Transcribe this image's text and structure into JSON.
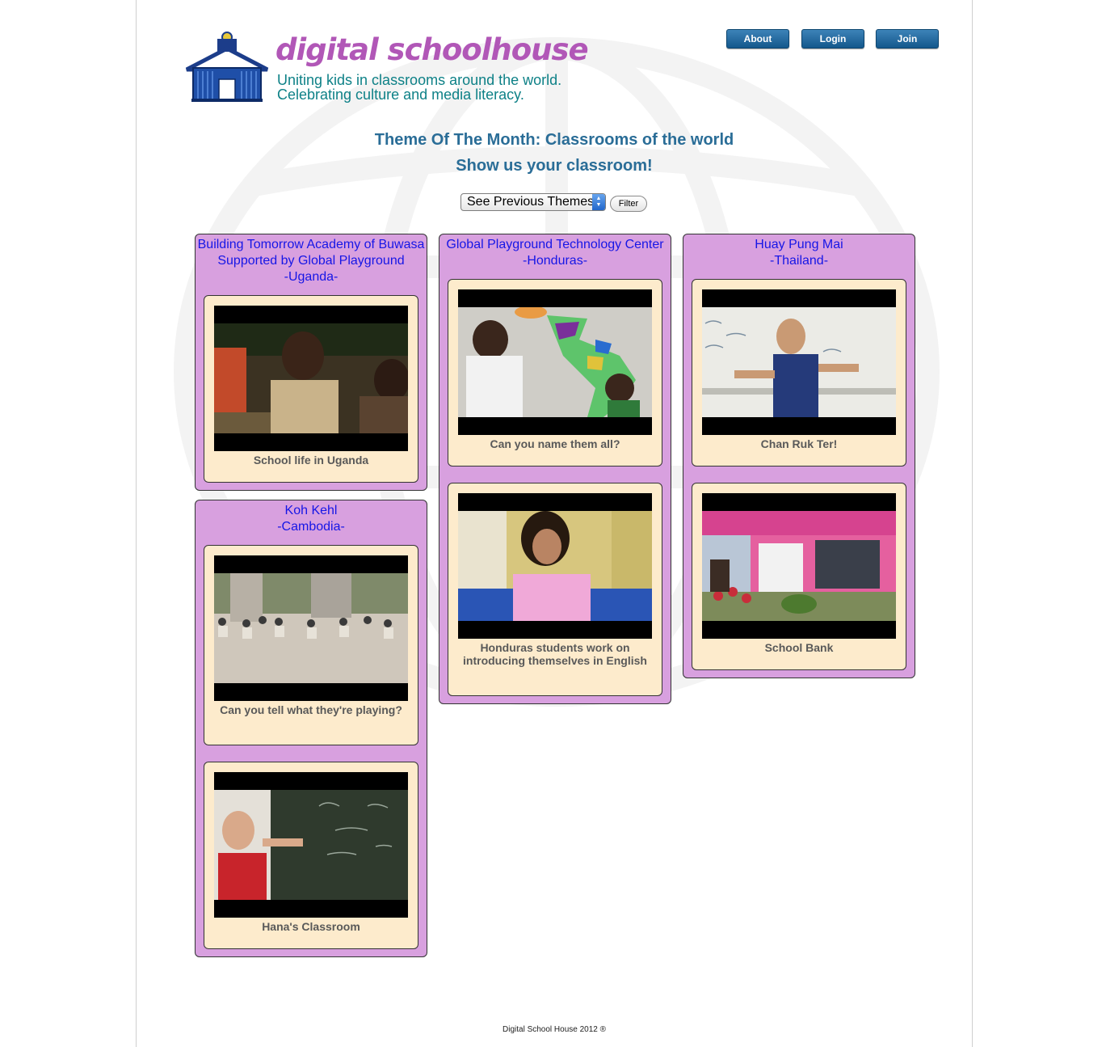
{
  "header": {
    "brand": "digital schoolhouse",
    "tagline_1": "Uniting kids in classrooms around the world.",
    "tagline_2": "Celebrating culture and media literacy."
  },
  "nav": {
    "about": "About",
    "login": "Login",
    "join": "Join"
  },
  "theme": {
    "title": "Theme Of The Month: Classrooms of the world",
    "subtitle": "Show us your classroom!",
    "select_value": "See Previous Themes",
    "filter_label": "Filter"
  },
  "groups": [
    {
      "title": [
        "Building Tomorrow Academy of Buwasa",
        "Supported by Global Playground",
        "-Uganda-"
      ],
      "videos": [
        "School life in Uganda"
      ]
    },
    {
      "title": [
        "Koh Kehl",
        "-Cambodia-"
      ],
      "videos": [
        "Can you tell what they're playing?",
        "Hana's Classroom"
      ]
    },
    {
      "title": [
        "Global Playground Technology Center",
        "-Honduras-"
      ],
      "videos": [
        "Can you name them all?",
        "Honduras students work on introducing themselves in English"
      ]
    },
    {
      "title": [
        "Huay Pung Mai",
        "-Thailand-"
      ],
      "videos": [
        "Chan Ruk Ter!",
        "School Bank"
      ]
    }
  ],
  "footer": "Digital School House 2012 ®",
  "colors": {
    "brand_purple": "#b157b7",
    "tagline_teal": "#0e8187",
    "heading_blue": "#2a6d97",
    "group_bg": "#d8a0df",
    "card_bg": "#fdebcc",
    "link_blue": "#1616e6",
    "button_blue": "#1f6aa3"
  }
}
